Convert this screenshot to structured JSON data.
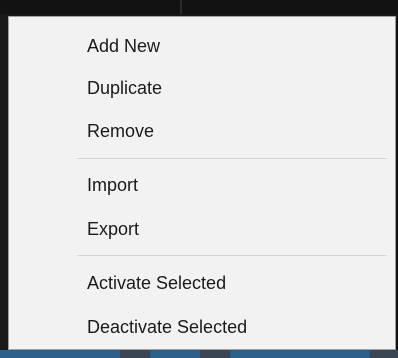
{
  "context_menu": {
    "items": [
      {
        "label": "Add New"
      },
      {
        "label": "Duplicate"
      },
      {
        "label": "Remove"
      },
      {
        "label": "Import"
      },
      {
        "label": "Export"
      },
      {
        "label": "Activate Selected"
      },
      {
        "label": "Deactivate Selected"
      }
    ]
  },
  "colors": {
    "menu_background": "#f2f2f2",
    "menu_border": "#a0a0a0",
    "separator": "#d4d4d4",
    "text": "#1a1a1a"
  }
}
